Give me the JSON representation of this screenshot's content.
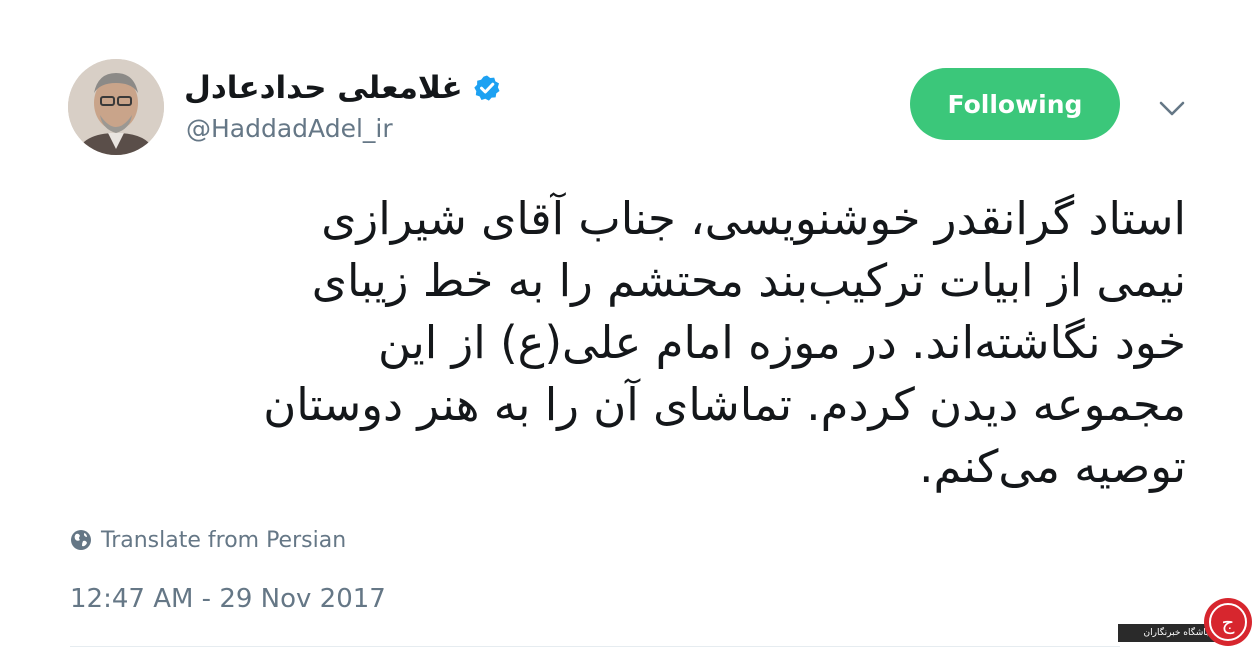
{
  "author": {
    "display_name": "غلامعلی حدادعادل",
    "handle": "@HaddadAdel_ir",
    "verified": true
  },
  "actions": {
    "follow_label": "Following",
    "follow_color": "#3bc77a",
    "menu_icon": "chevron-down-icon"
  },
  "tweet": {
    "lines": [
      "استاد گرانقدر خوشنویسی، جناب آقای شیرازی",
      "نیمی از ابیات ترکیب‌بند محتشم را به خط زیبای",
      "خود نگاشته‌اند. در موزه امام علی(ع) از این",
      "مجموعه دیدن کردم. تماشای آن را به هنر دوستان",
      "توصیه می‌کنم."
    ],
    "translate_label": "Translate from Persian",
    "timestamp": "12:47 AM - 29 Nov 2017"
  },
  "watermark": {
    "text": "باشگاه خبرنگاران",
    "logo_text": "ج"
  },
  "colors": {
    "text_primary": "#14171a",
    "text_secondary": "#657786",
    "verified_blue": "#1da1f2",
    "divider": "#e6ecf0"
  }
}
